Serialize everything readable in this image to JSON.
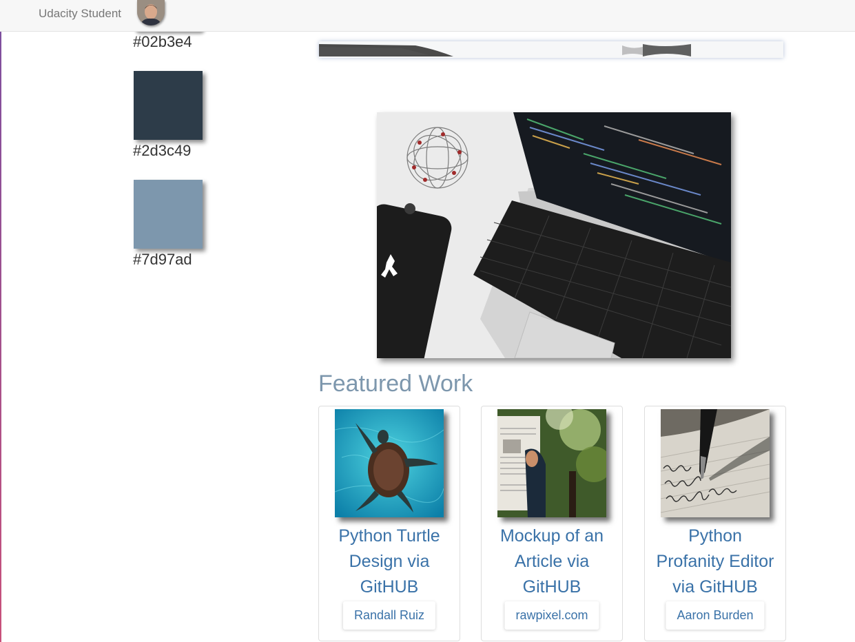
{
  "navbar": {
    "brand": "Udacity Student"
  },
  "palette": [
    {
      "hex": "#02b3e4",
      "label": "#02b3e4"
    },
    {
      "hex": "#2d3c49",
      "label": "#2d3c49"
    },
    {
      "hex": "#7d97ad",
      "label": "#7d97ad"
    }
  ],
  "featured": {
    "title": "Featured Work",
    "cards": [
      {
        "title_lines": [
          "Python Turtle",
          "Design via",
          "GitHUB"
        ],
        "credit": "Randall Ruiz"
      },
      {
        "title_lines": [
          "Mockup of an",
          "Article via",
          "GitHUB"
        ],
        "credit": "rawpixel.com"
      },
      {
        "title_lines": [
          "Python",
          "Profanity Editor",
          "via GitHUB"
        ],
        "credit": "Aaron Burden"
      }
    ]
  },
  "colors": {
    "accent": "#7d97ad",
    "link": "#3a72a8",
    "text": "#333333"
  }
}
